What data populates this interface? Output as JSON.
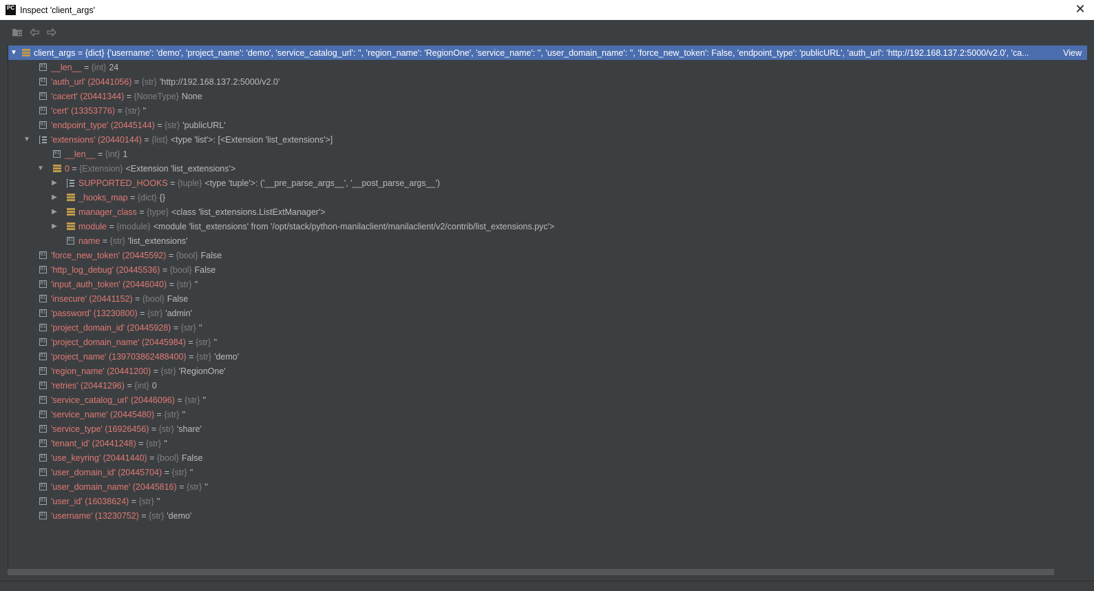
{
  "window": {
    "app_icon_text": "PC",
    "title": "Inspect 'client_args'",
    "close_glyph": "✕"
  },
  "toolbar": {
    "buttons": [
      {
        "name": "folder-icon"
      },
      {
        "name": "back-arrow-icon"
      },
      {
        "name": "forward-arrow-icon"
      }
    ]
  },
  "root": {
    "name": "client_args",
    "type": "{dict}",
    "value": "{'username': 'demo', 'project_name': 'demo', 'service_catalog_url': '', 'region_name': 'RegionOne', 'service_name': '', 'user_domain_name': '', 'force_new_token': False, 'endpoint_type': 'publicURL', 'auth_url': 'http://192.168.137.2:5000/v2.0', 'ca...",
    "view_link": "View"
  },
  "rows": [
    {
      "name": "__len__",
      "type": "{int}",
      "value": "24"
    },
    {
      "name": "'auth_url' (20441056)",
      "type": "{str}",
      "value": "'http://192.168.137.2:5000/v2.0'"
    },
    {
      "name": "'cacert' (20441344)",
      "type": "{NoneType}",
      "value": "None"
    },
    {
      "name": "'cert' (13353776)",
      "type": "{str}",
      "value": "''"
    },
    {
      "name": "'endpoint_type' (20445144)",
      "type": "{str}",
      "value": "'publicURL'"
    },
    {
      "name": "'extensions' (20440144)",
      "type": "{list}",
      "value": "<type 'list'>: [<Extension 'list_extensions'>]"
    },
    {
      "name": "__len__",
      "type": "{int}",
      "value": "1"
    },
    {
      "name": "0",
      "type": "{Extension}",
      "value": "<Extension 'list_extensions'>"
    },
    {
      "name": "SUPPORTED_HOOKS",
      "type": "{tuple}",
      "value": "<type 'tuple'>: ('__pre_parse_args__', '__post_parse_args__')"
    },
    {
      "name": "_hooks_map",
      "type": "{dict}",
      "value": "{}"
    },
    {
      "name": "manager_class",
      "type": "{type}",
      "value": "<class 'list_extensions.ListExtManager'>"
    },
    {
      "name": "module",
      "type": "{module}",
      "value": "<module 'list_extensions' from '/opt/stack/python-manilaclient/manilaclient/v2/contrib/list_extensions.pyc'>"
    },
    {
      "name": "name",
      "type": "{str}",
      "value": "'list_extensions'"
    },
    {
      "name": "'force_new_token' (20445592)",
      "type": "{bool}",
      "value": "False"
    },
    {
      "name": "'http_log_debug' (20445536)",
      "type": "{bool}",
      "value": "False"
    },
    {
      "name": "'input_auth_token' (20446040)",
      "type": "{str}",
      "value": "''"
    },
    {
      "name": "'insecure' (20441152)",
      "type": "{bool}",
      "value": "False"
    },
    {
      "name": "'password' (13230800)",
      "type": "{str}",
      "value": "'admin'"
    },
    {
      "name": "'project_domain_id' (20445928)",
      "type": "{str}",
      "value": "''"
    },
    {
      "name": "'project_domain_name' (20445984)",
      "type": "{str}",
      "value": "''"
    },
    {
      "name": "'project_name' (139703862488400)",
      "type": "{str}",
      "value": "'demo'"
    },
    {
      "name": "'region_name' (20441200)",
      "type": "{str}",
      "value": "'RegionOne'"
    },
    {
      "name": "'retries' (20441296)",
      "type": "{int}",
      "value": "0"
    },
    {
      "name": "'service_catalog_url' (20446096)",
      "type": "{str}",
      "value": "''"
    },
    {
      "name": "'service_name' (20445480)",
      "type": "{str}",
      "value": "''"
    },
    {
      "name": "'service_type' (16926456)",
      "type": "{str}",
      "value": "'share'"
    },
    {
      "name": "'tenant_id' (20441248)",
      "type": "{str}",
      "value": "''"
    },
    {
      "name": "'use_keyring' (20441440)",
      "type": "{bool}",
      "value": "False"
    },
    {
      "name": "'user_domain_id' (20445704)",
      "type": "{str}",
      "value": "''"
    },
    {
      "name": "'user_domain_name' (20445816)",
      "type": "{str}",
      "value": "''"
    },
    {
      "name": "'user_id' (16038624)",
      "type": "{str}",
      "value": "''"
    },
    {
      "name": "'username' (13230752)",
      "type": "{str}",
      "value": "'demo'"
    }
  ],
  "colors": {
    "background": "#3c3f41",
    "selection": "#4b6eaf",
    "variable_name": "#e07a76",
    "type_text": "#808080"
  }
}
